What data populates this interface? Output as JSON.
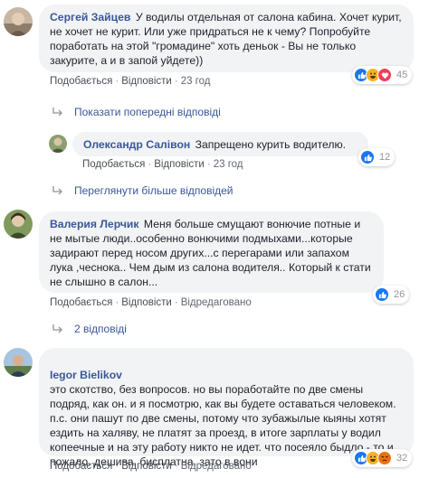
{
  "comments": [
    {
      "author": "Сергей Зайцев",
      "text": "У водилы отдельная от салона кабина. Хочет курит, не хочет не курит. Или уже придраться не к чему? Попробуйте поработать на этой \"громадине\" хоть деньок - Вы не только закурите, а и в запой уйдете))",
      "like": "Подобається",
      "reply": "Відповісти",
      "time": "23 год",
      "reactions": [
        "like",
        "haha",
        "love"
      ],
      "reaction_count": "45"
    },
    {
      "author": "Олександр Салівон",
      "text": "Запрещено курить водителю.",
      "like": "Подобається",
      "reply": "Відповісти",
      "time": "23 год",
      "reactions": [
        "like"
      ],
      "reaction_count": "12"
    },
    {
      "author": "Валерия Лерчик",
      "text": "Меня больше смущают вонючие потные и не мытые люди..особенно вонючими подмыхами...которые задирают перед носом других...с перегарами или запахом лука ,чеснока.. Чем дым из салона водителя.. Который к стати не слышно в салон...",
      "like": "Подобається",
      "reply": "Відповісти",
      "edited": "Відредаговано",
      "reactions": [
        "like"
      ],
      "reaction_count": "26"
    },
    {
      "author": "Iegor Bielikov",
      "text": "это скотство, без вопросов. но вы поработайте по две смены подряд, как он. и я посмотрю, как вы будете оставаться человеком.\nп.с. они пашут по две смены, потому что зубажылые кыяны хотят ездить на халяву, не платят за проезд, в итоге зарплаты у водил копеечные и на эту работу никто не идет. что посеяло быдло - то и пожало. дешива, бисплатна, зато в вони",
      "like": "Подобається",
      "reply": "Відповісти",
      "edited": "Відредаговано",
      "reactions": [
        "like",
        "haha",
        "angry"
      ],
      "reaction_count": "32"
    }
  ],
  "links": {
    "show_previous": "Показати попередні відповіді",
    "view_more": "Переглянути більше відповідей",
    "two_replies": "2 відповіді"
  },
  "colors": {
    "author": "#385898",
    "bubble": "#f2f3f5",
    "like_blue": "#1877f2"
  }
}
